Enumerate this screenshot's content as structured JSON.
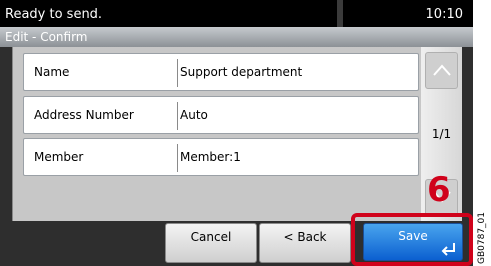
{
  "status": {
    "message": "Ready to send.",
    "time": "10:10"
  },
  "screen_title": "Edit - Confirm",
  "rows": [
    {
      "label": "Name",
      "value": "Support department"
    },
    {
      "label": "Address Number",
      "value": "Auto"
    },
    {
      "label": "Member",
      "value": "Member:1"
    }
  ],
  "pager": {
    "page": "1/1",
    "up_icon": "chevron-up-icon",
    "down_icon": "chevron-down-icon"
  },
  "buttons": {
    "cancel": "Cancel",
    "back": "< Back",
    "save": "Save",
    "save_icon": "enter-icon"
  },
  "annotation": {
    "step": "6",
    "figure_code": "GB0787_01"
  },
  "colors": {
    "highlight": "#d0021b",
    "save_button": "#1f7fe0"
  }
}
